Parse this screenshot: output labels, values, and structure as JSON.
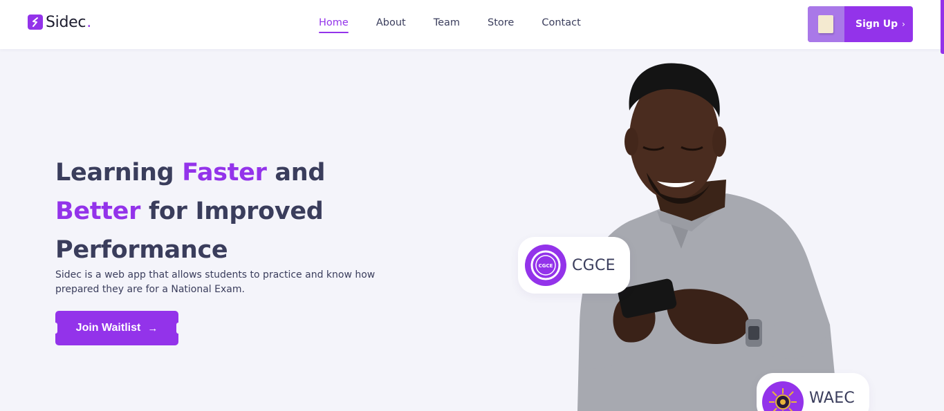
{
  "brand": {
    "name": "Sidec",
    "dot": ".",
    "accent_color": "#9333ea",
    "text_color": "#3a3d5c"
  },
  "nav": {
    "links": [
      {
        "label": "Home",
        "active": true
      },
      {
        "label": "About",
        "active": false
      },
      {
        "label": "Team",
        "active": false
      },
      {
        "label": "Store",
        "active": false
      },
      {
        "label": "Contact",
        "active": false
      }
    ],
    "signup_label": "Sign Up",
    "signup_chevron": "›"
  },
  "hero": {
    "title_parts": {
      "p1": "Learning ",
      "p2": "Faster",
      "p3": " and ",
      "p4": "Better",
      "p5": " for Improved Performance"
    },
    "description": "Sidec is a web app that allows students to practice and know how prepared they are for a National Exam.",
    "cta_label": "Join Waitlist",
    "cta_arrow": "→"
  },
  "badges": {
    "cgce": {
      "label": "CGCE",
      "emblem_text": "CGCE"
    },
    "waec": {
      "label": "WAEC"
    }
  },
  "icons": [
    "logo-icon",
    "note-icon",
    "arrow-right-icon",
    "chevron-right-icon",
    "cgce-emblem-icon",
    "waec-emblem-icon"
  ]
}
